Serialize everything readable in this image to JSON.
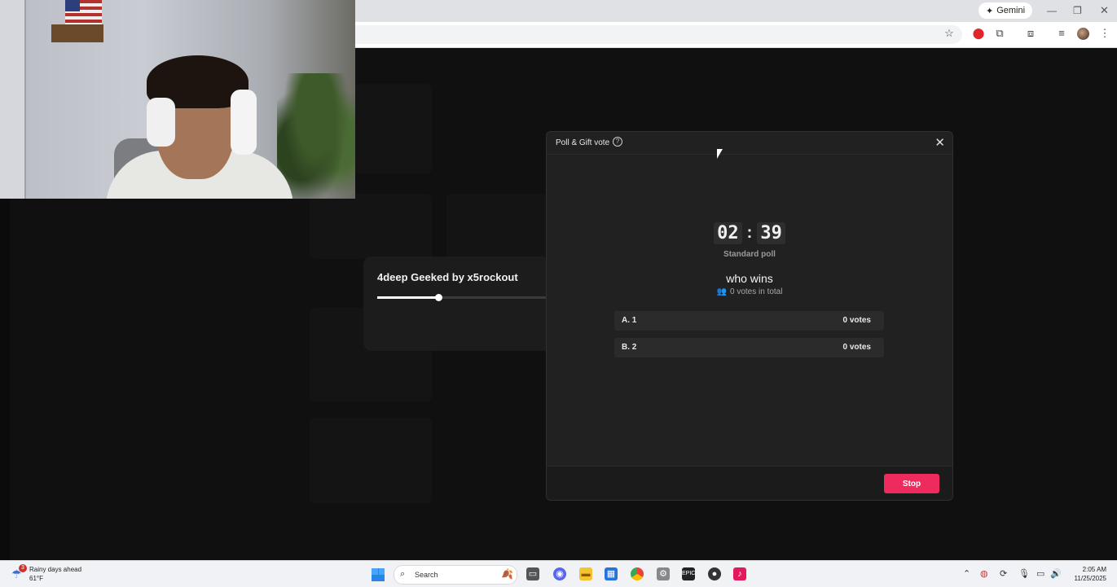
{
  "browser": {
    "gemini_label": "Gemini"
  },
  "song_card": {
    "title": "4deep Geeked by x5rockout",
    "progress": 0.35
  },
  "poll": {
    "modal_title": "Poll & Gift vote",
    "timer_minutes": "02",
    "timer_separator": ":",
    "timer_seconds": "39",
    "poll_type": "Standard poll",
    "question": "who wins",
    "total_votes": "0 votes in total",
    "options": [
      {
        "label": "A. 1",
        "votes": "0 votes"
      },
      {
        "label": "B. 2",
        "votes": "0 votes"
      }
    ],
    "stop_label": "Stop",
    "accent_color": "#ef2a5c"
  },
  "taskbar": {
    "weather_badge": "3",
    "weather_title": "Rainy days ahead",
    "weather_temp": "61°F",
    "search_label": "Search",
    "time": "2:05 AM",
    "date": "11/25/2025"
  }
}
